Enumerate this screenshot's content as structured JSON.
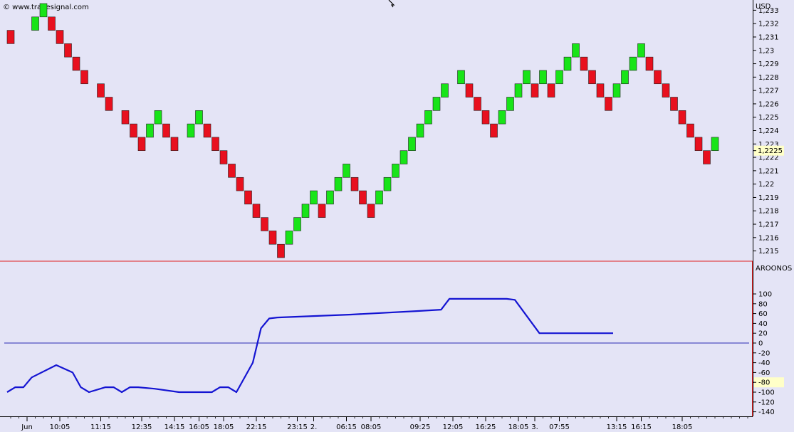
{
  "header": {
    "credit": "© www.tradesignal.com"
  },
  "colors": {
    "background": "#e4e4f6",
    "up_brick": "#18e418",
    "down_brick": "#e8101e",
    "brick_border": "#202020",
    "aroon_line": "#1414d2",
    "zero_line": "#2a2ab4",
    "separator": "#e02020",
    "last_value_bg": "#ffffc8"
  },
  "chart_data": [
    {
      "type": "renko",
      "unit_label": "USD",
      "brick_size": 0.001,
      "ylim": [
        1.2145,
        1.2335
      ],
      "y_ticks": [
        1.215,
        1.216,
        1.217,
        1.218,
        1.219,
        1.22,
        1.221,
        1.222,
        1.223,
        1.224,
        1.225,
        1.226,
        1.227,
        1.228,
        1.229,
        1.23,
        1.231,
        1.232,
        1.233
      ],
      "y_tick_labels": [
        "1,215",
        "1,216",
        "1,217",
        "1,218",
        "1,219",
        "1,22",
        "1,221",
        "1,222",
        "1,223",
        "1,224",
        "1,225",
        "1,226",
        "1,227",
        "1,228",
        "1,229",
        "1,23",
        "1,231",
        "1,232",
        "1,233"
      ],
      "last_value_label": "1,2225",
      "last_value": 1.2225,
      "bricks": [
        {
          "c": 0,
          "y": 1.2305,
          "dir": "down"
        },
        {
          "c": 3,
          "y": 1.2315,
          "dir": "up"
        },
        {
          "c": 4,
          "y": 1.2325,
          "dir": "up"
        },
        {
          "c": 5,
          "y": 1.2315,
          "dir": "down"
        },
        {
          "c": 6,
          "y": 1.2305,
          "dir": "down"
        },
        {
          "c": 7,
          "y": 1.2295,
          "dir": "down"
        },
        {
          "c": 8,
          "y": 1.2285,
          "dir": "down"
        },
        {
          "c": 9,
          "y": 1.2275,
          "dir": "down"
        },
        {
          "c": 11,
          "y": 1.2265,
          "dir": "down"
        },
        {
          "c": 12,
          "y": 1.2255,
          "dir": "down"
        },
        {
          "c": 14,
          "y": 1.2245,
          "dir": "down"
        },
        {
          "c": 15,
          "y": 1.2235,
          "dir": "down"
        },
        {
          "c": 16,
          "y": 1.2225,
          "dir": "down"
        },
        {
          "c": 17,
          "y": 1.2235,
          "dir": "up"
        },
        {
          "c": 18,
          "y": 1.2245,
          "dir": "up"
        },
        {
          "c": 19,
          "y": 1.2235,
          "dir": "down"
        },
        {
          "c": 20,
          "y": 1.2225,
          "dir": "down"
        },
        {
          "c": 22,
          "y": 1.2235,
          "dir": "up"
        },
        {
          "c": 23,
          "y": 1.2245,
          "dir": "up"
        },
        {
          "c": 24,
          "y": 1.2235,
          "dir": "down"
        },
        {
          "c": 25,
          "y": 1.2225,
          "dir": "down"
        },
        {
          "c": 26,
          "y": 1.2215,
          "dir": "down"
        },
        {
          "c": 27,
          "y": 1.2205,
          "dir": "down"
        },
        {
          "c": 28,
          "y": 1.2195,
          "dir": "down"
        },
        {
          "c": 29,
          "y": 1.2185,
          "dir": "down"
        },
        {
          "c": 30,
          "y": 1.2175,
          "dir": "down"
        },
        {
          "c": 31,
          "y": 1.2165,
          "dir": "down"
        },
        {
          "c": 32,
          "y": 1.2155,
          "dir": "down"
        },
        {
          "c": 33,
          "y": 1.2145,
          "dir": "down"
        },
        {
          "c": 34,
          "y": 1.2155,
          "dir": "up"
        },
        {
          "c": 35,
          "y": 1.2165,
          "dir": "up"
        },
        {
          "c": 36,
          "y": 1.2175,
          "dir": "up"
        },
        {
          "c": 37,
          "y": 1.2185,
          "dir": "up"
        },
        {
          "c": 38,
          "y": 1.2175,
          "dir": "down"
        },
        {
          "c": 39,
          "y": 1.2185,
          "dir": "up"
        },
        {
          "c": 40,
          "y": 1.2195,
          "dir": "up"
        },
        {
          "c": 41,
          "y": 1.2205,
          "dir": "up"
        },
        {
          "c": 42,
          "y": 1.2195,
          "dir": "down"
        },
        {
          "c": 43,
          "y": 1.2185,
          "dir": "down"
        },
        {
          "c": 44,
          "y": 1.2175,
          "dir": "down"
        },
        {
          "c": 45,
          "y": 1.2185,
          "dir": "up"
        },
        {
          "c": 46,
          "y": 1.2195,
          "dir": "up"
        },
        {
          "c": 47,
          "y": 1.2205,
          "dir": "up"
        },
        {
          "c": 48,
          "y": 1.2215,
          "dir": "up"
        },
        {
          "c": 49,
          "y": 1.2225,
          "dir": "up"
        },
        {
          "c": 50,
          "y": 1.2235,
          "dir": "up"
        },
        {
          "c": 51,
          "y": 1.2245,
          "dir": "up"
        },
        {
          "c": 52,
          "y": 1.2255,
          "dir": "up"
        },
        {
          "c": 53,
          "y": 1.2265,
          "dir": "up"
        },
        {
          "c": 55,
          "y": 1.2275,
          "dir": "up"
        },
        {
          "c": 56,
          "y": 1.2265,
          "dir": "down"
        },
        {
          "c": 57,
          "y": 1.2255,
          "dir": "down"
        },
        {
          "c": 58,
          "y": 1.2245,
          "dir": "down"
        },
        {
          "c": 59,
          "y": 1.2235,
          "dir": "down"
        },
        {
          "c": 60,
          "y": 1.2245,
          "dir": "up"
        },
        {
          "c": 61,
          "y": 1.2255,
          "dir": "up"
        },
        {
          "c": 62,
          "y": 1.2265,
          "dir": "up"
        },
        {
          "c": 63,
          "y": 1.2275,
          "dir": "up"
        },
        {
          "c": 64,
          "y": 1.2265,
          "dir": "down"
        },
        {
          "c": 65,
          "y": 1.2275,
          "dir": "up"
        },
        {
          "c": 66,
          "y": 1.2265,
          "dir": "down"
        },
        {
          "c": 67,
          "y": 1.2275,
          "dir": "up"
        },
        {
          "c": 68,
          "y": 1.2285,
          "dir": "up"
        },
        {
          "c": 69,
          "y": 1.2295,
          "dir": "up"
        },
        {
          "c": 70,
          "y": 1.2285,
          "dir": "down"
        },
        {
          "c": 71,
          "y": 1.2275,
          "dir": "down"
        },
        {
          "c": 72,
          "y": 1.2265,
          "dir": "down"
        },
        {
          "c": 73,
          "y": 1.2255,
          "dir": "down"
        },
        {
          "c": 74,
          "y": 1.2265,
          "dir": "up"
        },
        {
          "c": 75,
          "y": 1.2275,
          "dir": "up"
        },
        {
          "c": 76,
          "y": 1.2285,
          "dir": "up"
        },
        {
          "c": 77,
          "y": 1.2295,
          "dir": "up"
        },
        {
          "c": 78,
          "y": 1.2285,
          "dir": "down"
        },
        {
          "c": 79,
          "y": 1.2275,
          "dir": "down"
        },
        {
          "c": 80,
          "y": 1.2265,
          "dir": "down"
        },
        {
          "c": 81,
          "y": 1.2255,
          "dir": "down"
        },
        {
          "c": 82,
          "y": 1.2245,
          "dir": "down"
        },
        {
          "c": 83,
          "y": 1.2235,
          "dir": "down"
        },
        {
          "c": 84,
          "y": 1.2225,
          "dir": "down"
        },
        {
          "c": 85,
          "y": 1.2215,
          "dir": "down"
        },
        {
          "c": 86,
          "y": 1.2225,
          "dir": "up"
        }
      ]
    },
    {
      "type": "line",
      "title": "AROONOS",
      "ylim": [
        -140,
        120
      ],
      "y_ticks": [
        100,
        80,
        60,
        40,
        20,
        0,
        -20,
        -40,
        -60,
        -80,
        -100,
        -120,
        -140
      ],
      "y_tick_labels": [
        "100",
        "80",
        "60",
        "40",
        "20",
        "0",
        "-20",
        "-40",
        "-60",
        "-80",
        "-100",
        "-120",
        "-140"
      ],
      "last_value_label": "-80",
      "last_value": -80,
      "zero_line": 0,
      "x": [
        0,
        1,
        2,
        3,
        6,
        8,
        9,
        10,
        12,
        13,
        14,
        15,
        16,
        18,
        21,
        25,
        26,
        27,
        28,
        30,
        31,
        32,
        33,
        42,
        50,
        53,
        54,
        61,
        62,
        65,
        74
      ],
      "values": [
        -100,
        -90,
        -90,
        -70,
        -45,
        -60,
        -90,
        -100,
        -90,
        -90,
        -100,
        -90,
        -90,
        -93,
        -100,
        -100,
        -90,
        -90,
        -100,
        -40,
        30,
        50,
        52,
        58,
        65,
        68,
        90,
        90,
        88,
        20,
        20
      ]
    }
  ],
  "x_axis": {
    "labels": [
      {
        "c": 2,
        "text": "Jun"
      },
      {
        "c": 6,
        "text": "10:05"
      },
      {
        "c": 11,
        "text": "11:15"
      },
      {
        "c": 16,
        "text": "12:35"
      },
      {
        "c": 20,
        "text": "14:15"
      },
      {
        "c": 23,
        "text": "16:05"
      },
      {
        "c": 26,
        "text": "18:05"
      },
      {
        "c": 30,
        "text": "22:15"
      },
      {
        "c": 35,
        "text": "23:15"
      },
      {
        "c": 37,
        "text": "2."
      },
      {
        "c": 41,
        "text": "06:15"
      },
      {
        "c": 44,
        "text": "08:05"
      },
      {
        "c": 50,
        "text": "09:25"
      },
      {
        "c": 54,
        "text": "12:05"
      },
      {
        "c": 58,
        "text": "16:25"
      },
      {
        "c": 62,
        "text": "18:05"
      },
      {
        "c": 64,
        "text": "3."
      },
      {
        "c": 67,
        "text": "07:55"
      },
      {
        "c": 74,
        "text": "13:15"
      },
      {
        "c": 77,
        "text": "16:15"
      },
      {
        "c": 82,
        "text": "18:05"
      }
    ]
  }
}
